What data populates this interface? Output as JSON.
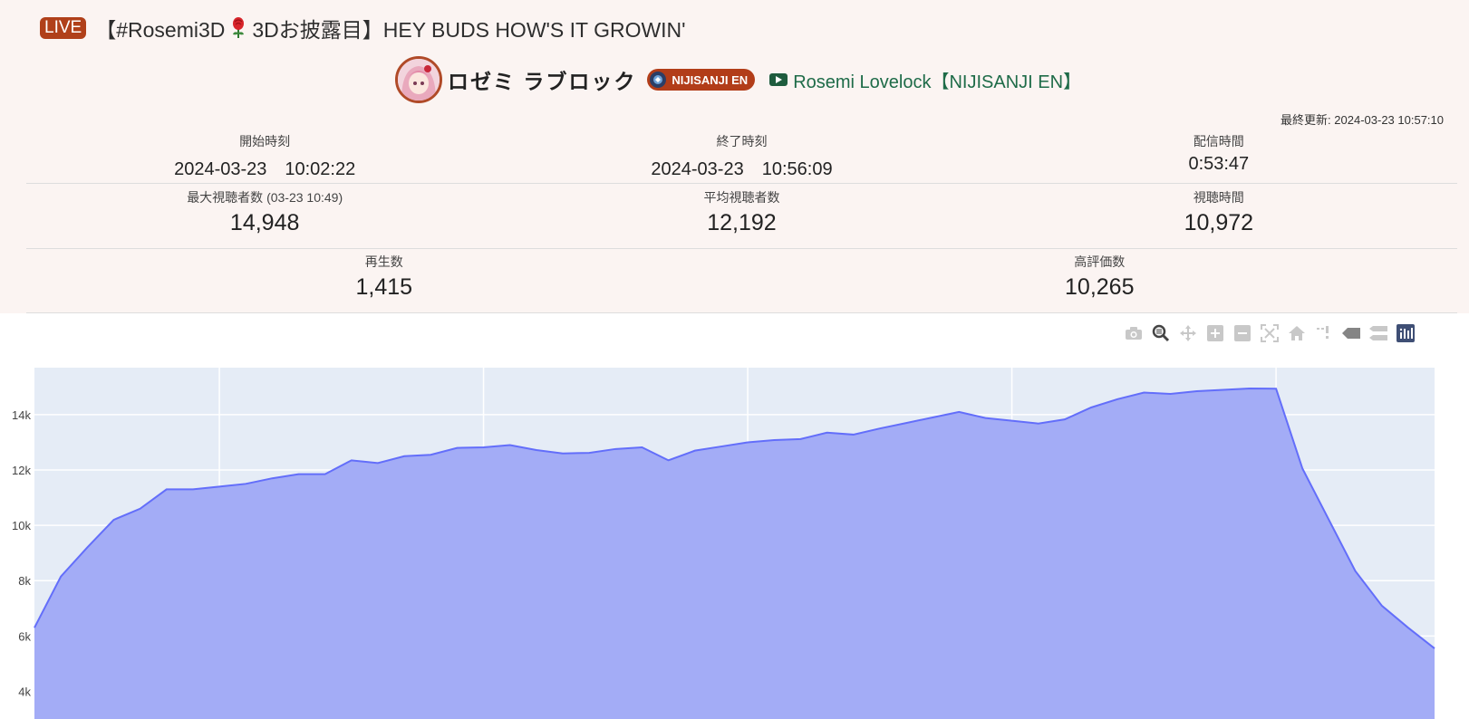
{
  "header": {
    "live_badge": "LIVE",
    "title_prefix": "【#Rosemi3D",
    "title_suffix": "3Dお披露目】HEY BUDS HOW'S IT GROWIN'"
  },
  "channel": {
    "name": "ロゼミ ラブロック",
    "agency_badge": "NIJISANJI EN",
    "youtube_link": "Rosemi Lovelock【NIJISANJI EN】"
  },
  "last_updated": {
    "label": "最終更新",
    "value": "2024-03-23 10:57:10"
  },
  "stats": {
    "start_label": "開始時刻",
    "start_value": "2024-03-23　10:02:22",
    "end_label": "終了時刻",
    "end_value": "2024-03-23　10:56:09",
    "duration_label": "配信時間",
    "duration_value": "0:53:47",
    "max_viewers_label": "最大視聴者数 (03-23 10:49)",
    "max_viewers_value": "14,948",
    "avg_viewers_label": "平均視聴者数",
    "avg_viewers_value": "12,192",
    "watch_time_label": "視聴時間",
    "watch_time_value": "10,972",
    "plays_label": "再生数",
    "plays_value": "1,415",
    "likes_label": "高評価数",
    "likes_value": "10,265"
  },
  "modebar": {
    "icons": [
      "camera-icon",
      "zoom-icon",
      "pan-icon",
      "zoom-in-icon",
      "zoom-out-icon",
      "autoscale-icon",
      "home-icon",
      "spike-lines-icon",
      "hover-closest-icon",
      "hover-compare-icon",
      "plotly-logo-icon"
    ]
  },
  "chart_data": {
    "type": "area",
    "title": "",
    "xlabel": "",
    "ylabel": "",
    "y_ticks": [
      "4k",
      "6k",
      "8k",
      "10k",
      "12k",
      "14k"
    ],
    "ylim": [
      3000,
      15700
    ],
    "x": [
      0,
      1,
      2,
      3,
      4,
      5,
      6,
      7,
      8,
      9,
      10,
      11,
      12,
      13,
      14,
      15,
      16,
      17,
      18,
      19,
      20,
      21,
      22,
      23,
      24,
      25,
      26,
      27,
      28,
      29,
      30,
      31,
      32,
      33,
      34,
      35,
      36,
      37,
      38,
      39,
      40,
      41,
      42,
      43,
      44,
      45,
      46,
      47,
      48,
      49,
      50,
      51,
      52,
      53
    ],
    "values": [
      6300,
      8150,
      9200,
      10200,
      10600,
      11300,
      11300,
      11400,
      11500,
      11700,
      11850,
      11850,
      12350,
      12250,
      12500,
      12550,
      12800,
      12820,
      12900,
      12720,
      12600,
      12620,
      12760,
      12820,
      12350,
      12700,
      12850,
      13000,
      13080,
      13120,
      13350,
      13280,
      13500,
      13700,
      13900,
      14100,
      13880,
      13780,
      13680,
      13830,
      14260,
      14560,
      14800,
      14750,
      14850,
      14900,
      14948,
      14940,
      12050,
      10200,
      8350,
      7100,
      6300,
      5550
    ],
    "grid": true,
    "fill_color": "#a3acf6",
    "line_color": "#636efa",
    "plot_bg": "#e5ecf6"
  }
}
